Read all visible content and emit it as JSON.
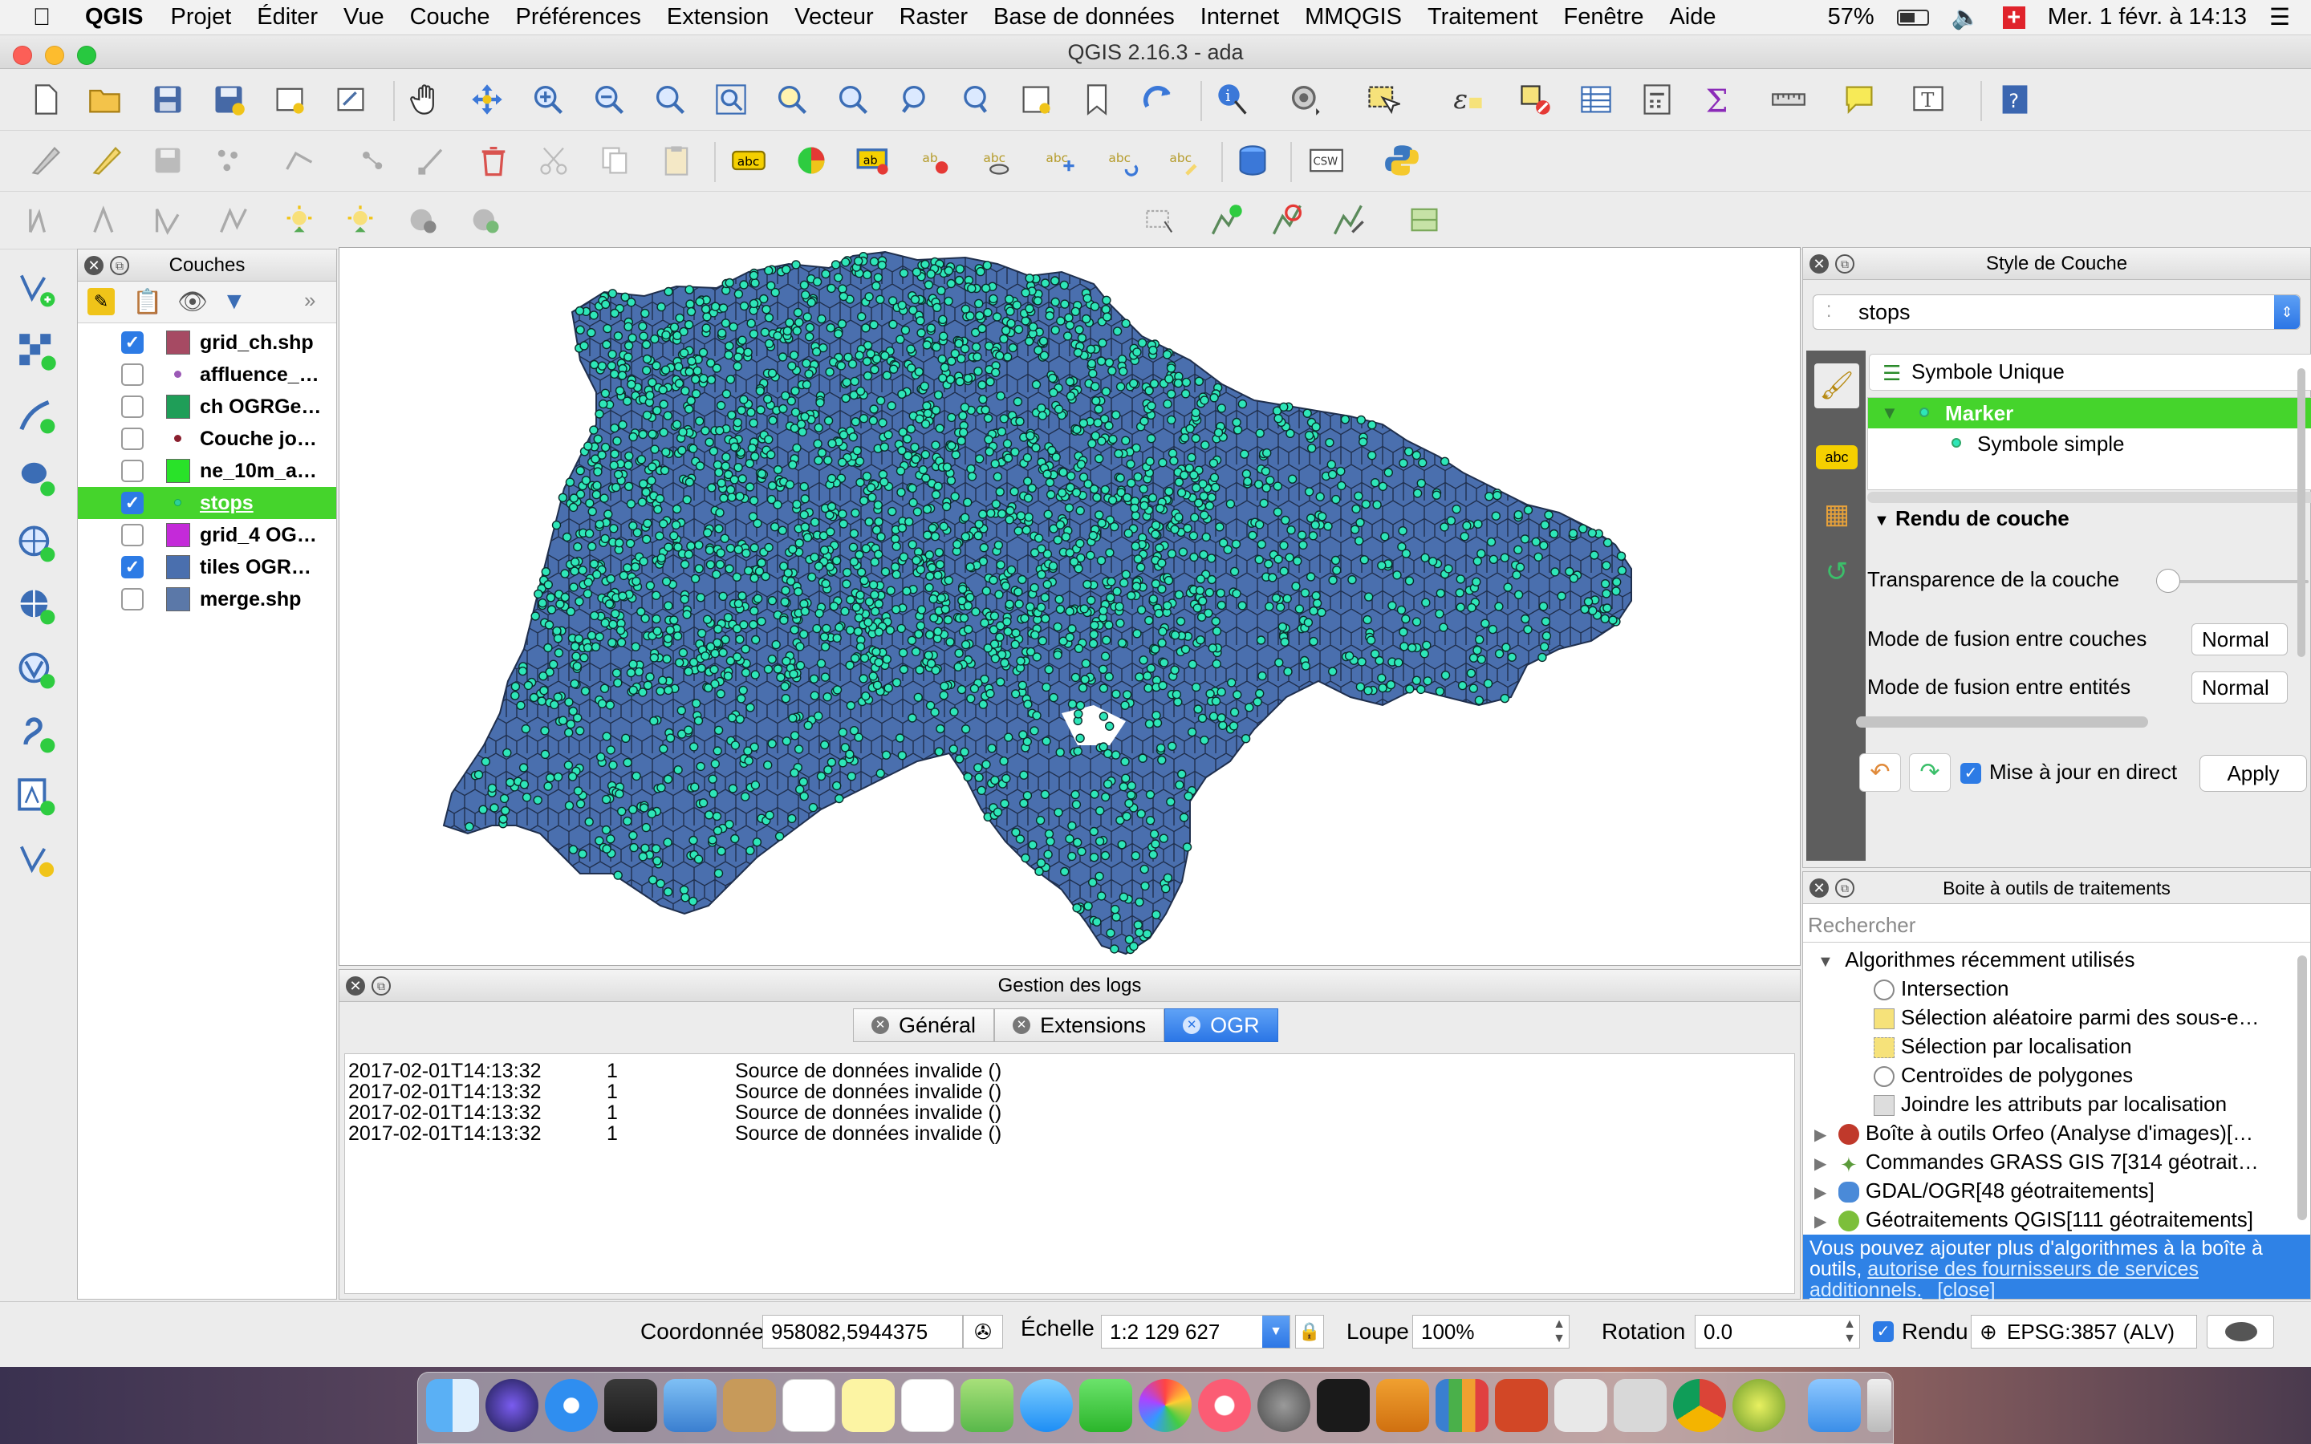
{
  "menubar": {
    "app": "QGIS",
    "items": [
      "Projet",
      "Éditer",
      "Vue",
      "Couche",
      "Préférences",
      "Extension",
      "Vecteur",
      "Raster",
      "Base de données",
      "Internet",
      "MMQGIS",
      "Traitement",
      "Fenêtre",
      "Aide"
    ],
    "battery": "57%",
    "datetime": "Mer. 1 févr. à 14:13"
  },
  "window": {
    "title": "QGIS 2.16.3 - ada"
  },
  "layers_panel": {
    "title": "Couches",
    "layers": [
      {
        "name": "grid_ch.shp",
        "checked": true,
        "color": "#a64a63"
      },
      {
        "name": "affluence_…",
        "checked": false,
        "color": "#9b59b6"
      },
      {
        "name": "ch OGRGe…",
        "checked": false,
        "color": "#1f9e58"
      },
      {
        "name": "Couche jo…",
        "checked": false,
        "color": "#8a1f2e"
      },
      {
        "name": "ne_10m_a…",
        "checked": false,
        "color": "#29e229"
      },
      {
        "name": "stops",
        "checked": true,
        "color": "#2ecf9b",
        "selected": true
      },
      {
        "name": "grid_4 OG…",
        "checked": false,
        "color": "#c42ad9"
      },
      {
        "name": "tiles OGR…",
        "checked": true,
        "color": "#4a6fae"
      },
      {
        "name": "merge.shp",
        "checked": false,
        "color": "#5b78a8"
      }
    ]
  },
  "logs": {
    "title": "Gestion des logs",
    "tabs": [
      "Général",
      "Extensions",
      "OGR"
    ],
    "active_tab": "OGR",
    "entries": [
      {
        "time": "2017-02-01T14:13:32",
        "level": "1",
        "message": "Source de données invalide ()"
      },
      {
        "time": "2017-02-01T14:13:32",
        "level": "1",
        "message": "Source de données invalide ()"
      },
      {
        "time": "2017-02-01T14:13:32",
        "level": "1",
        "message": "Source de données invalide ()"
      },
      {
        "time": "2017-02-01T14:13:32",
        "level": "1",
        "message": "Source de données invalide ()"
      }
    ]
  },
  "style_panel": {
    "title": "Style de Couche",
    "layer": "stops",
    "renderer": "Symbole Unique",
    "tree": {
      "root": "Marker",
      "child": "Symbole simple"
    },
    "section": "Rendu de couche",
    "transparency_label": "Transparence de la couche",
    "transparency_value": 0,
    "blend_layers_label": "Mode de fusion entre couches",
    "blend_layers_value": "Normal",
    "blend_features_label": "Mode de fusion entre entités",
    "blend_features_value": "Normal",
    "live_update_label": "Mise à jour en direct",
    "live_update_checked": true,
    "apply": "Apply"
  },
  "processing": {
    "title": "Boite à outils de traitements",
    "search_placeholder": "Rechercher",
    "recent_group": "Algorithmes récemment utilisés",
    "recent": [
      "Intersection",
      "Sélection aléatoire parmi des sous-e…",
      "Sélection par localisation",
      "Centroïdes de polygones",
      "Joindre les attributs par localisation"
    ],
    "providers": [
      "Boîte à outils Orfeo (Analyse d'images)[…",
      "Commandes GRASS GIS 7[314 géotrait…",
      "GDAL/OGR[48 géotraitements]",
      "Géotraitements QGIS[111 géotraitements]"
    ],
    "note_text": "Vous pouvez ajouter plus d'algorithmes à la boîte à outils,",
    "note_link": "autorise des fournisseurs de services additionnels.",
    "note_close": "[close]"
  },
  "statusbar": {
    "coord_label": "Coordonnée",
    "coord_value": "958082,5944375",
    "scale_label": "Échelle",
    "scale_value": "1:2 129 627",
    "zoom_label": "Loupe",
    "zoom_value": "100%",
    "rotation_label": "Rotation",
    "rotation_value": "0.0",
    "render_label": "Rendu",
    "crs": "EPSG:3857 (ALV)"
  },
  "colors": {
    "accent": "#2b76e6",
    "selected_layer": "#45d42c",
    "hex_fill": "#4a6fae",
    "stop_fill": "#2ee6b8"
  }
}
